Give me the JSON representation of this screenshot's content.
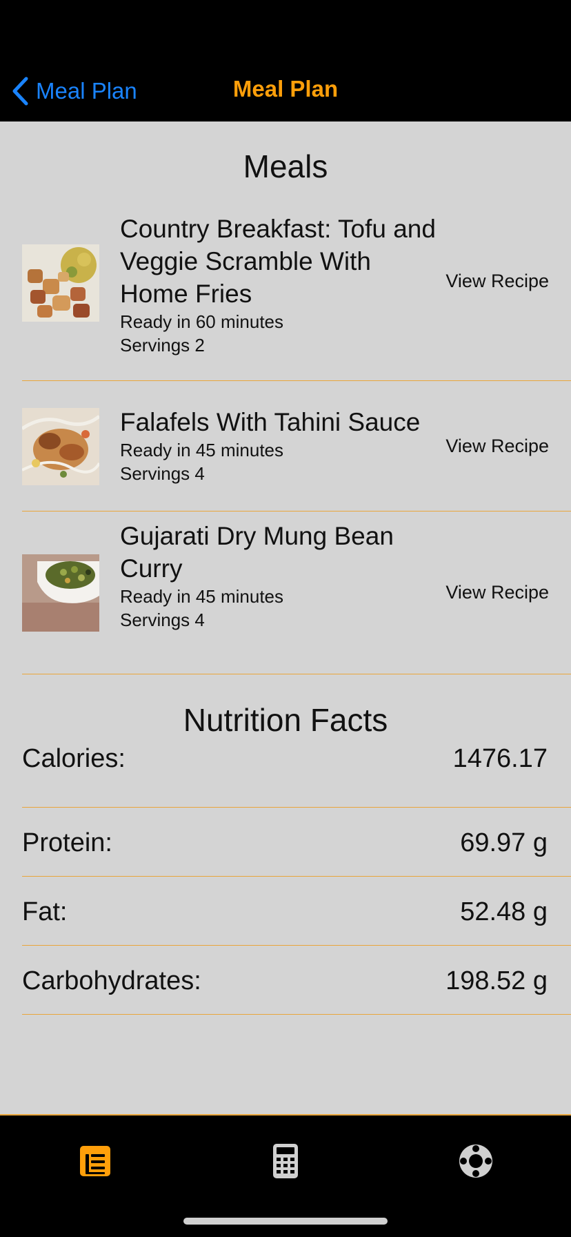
{
  "nav": {
    "back_label": "Meal Plan",
    "title": "Meal Plan"
  },
  "sections": {
    "meals_title": "Meals",
    "nutrition_title": "Nutrition Facts"
  },
  "meals": [
    {
      "title": "Country Breakfast: Tofu and Veggie Scramble With Home Fries",
      "ready": "Ready in 60 minutes",
      "servings": "Servings 2",
      "action": "View Recipe"
    },
    {
      "title": "Falafels With Tahini Sauce",
      "ready": "Ready in 45 minutes",
      "servings": "Servings 4",
      "action": "View Recipe"
    },
    {
      "title": "Gujarati Dry Mung Bean Curry",
      "ready": "Ready in 45 minutes",
      "servings": "Servings 4",
      "action": "View Recipe"
    }
  ],
  "nutrition": [
    {
      "label": "Calories:",
      "value": "1476.17"
    },
    {
      "label": "Protein:",
      "value": "69.97 g"
    },
    {
      "label": "Fat:",
      "value": "52.48 g"
    },
    {
      "label": "Carbohydrates:",
      "value": "198.52 g"
    }
  ],
  "tabs": [
    {
      "icon": "list-icon",
      "active": true
    },
    {
      "icon": "calculator-icon",
      "active": false
    },
    {
      "icon": "lifebuoy-icon",
      "active": false
    }
  ],
  "colors": {
    "accent": "#ff9f0a",
    "link": "#1a84ff",
    "divider": "#e9a53a",
    "background": "#d4d4d4",
    "bars": "#000000"
  }
}
